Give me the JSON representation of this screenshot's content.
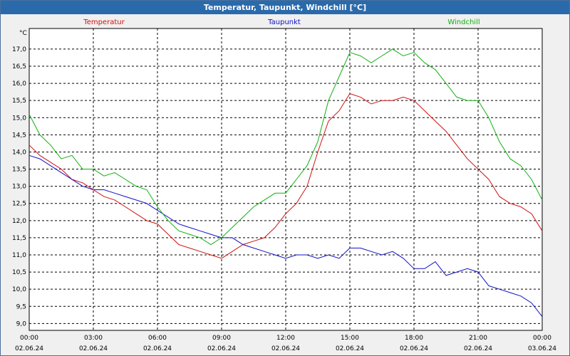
{
  "window": {
    "title": "Temperatur, Taupunkt, Windchill [°C]"
  },
  "chart_data": {
    "type": "line",
    "title": "Temperatur, Taupunkt, Windchill [°C]",
    "ylabel": "°C",
    "ylim": [
      8.8,
      17.6
    ],
    "xlim": [
      "02.06.24 00:00",
      "03.06.24 00:00"
    ],
    "grid": true,
    "legend": "top",
    "x_ticks": [
      {
        "time": "00:00",
        "date": "02.06.24"
      },
      {
        "time": "03:00",
        "date": "02.06.24"
      },
      {
        "time": "06:00",
        "date": "02.06.24"
      },
      {
        "time": "09:00",
        "date": "02.06.24"
      },
      {
        "time": "12:00",
        "date": "02.06.24"
      },
      {
        "time": "15:00",
        "date": "02.06.24"
      },
      {
        "time": "18:00",
        "date": "02.06.24"
      },
      {
        "time": "21:00",
        "date": "02.06.24"
      },
      {
        "time": "00:00",
        "date": "03.06.24"
      }
    ],
    "y_ticks": [
      "9,0",
      "9,5",
      "10,0",
      "10,5",
      "11,0",
      "11,5",
      "12,0",
      "12,5",
      "13,0",
      "13,5",
      "14,0",
      "14,5",
      "15,0",
      "15,5",
      "16,0",
      "16,5",
      "17,0"
    ],
    "series": [
      {
        "name": "Temperatur",
        "color": "#d01010",
        "points": [
          [
            "00:00",
            14.2
          ],
          [
            "00:30",
            13.9
          ],
          [
            "01:00",
            13.7
          ],
          [
            "01:30",
            13.5
          ],
          [
            "02:00",
            13.2
          ],
          [
            "02:30",
            13.1
          ],
          [
            "03:00",
            12.9
          ],
          [
            "03:30",
            12.7
          ],
          [
            "04:00",
            12.6
          ],
          [
            "04:30",
            12.4
          ],
          [
            "05:00",
            12.2
          ],
          [
            "05:30",
            12.0
          ],
          [
            "06:00",
            11.9
          ],
          [
            "06:30",
            11.6
          ],
          [
            "07:00",
            11.3
          ],
          [
            "07:30",
            11.2
          ],
          [
            "08:00",
            11.1
          ],
          [
            "08:30",
            11.0
          ],
          [
            "09:00",
            10.9
          ],
          [
            "09:30",
            11.1
          ],
          [
            "10:00",
            11.3
          ],
          [
            "10:30",
            11.4
          ],
          [
            "11:00",
            11.5
          ],
          [
            "11:30",
            11.8
          ],
          [
            "12:00",
            12.2
          ],
          [
            "12:30",
            12.5
          ],
          [
            "13:00",
            13.0
          ],
          [
            "13:30",
            14.0
          ],
          [
            "14:00",
            14.9
          ],
          [
            "14:30",
            15.2
          ],
          [
            "15:00",
            15.7
          ],
          [
            "15:30",
            15.6
          ],
          [
            "16:00",
            15.4
          ],
          [
            "16:30",
            15.5
          ],
          [
            "17:00",
            15.5
          ],
          [
            "17:30",
            15.6
          ],
          [
            "18:00",
            15.5
          ],
          [
            "18:30",
            15.2
          ],
          [
            "19:00",
            14.9
          ],
          [
            "19:30",
            14.6
          ],
          [
            "20:00",
            14.2
          ],
          [
            "20:30",
            13.8
          ],
          [
            "21:00",
            13.5
          ],
          [
            "21:30",
            13.2
          ],
          [
            "22:00",
            12.7
          ],
          [
            "22:30",
            12.5
          ],
          [
            "23:00",
            12.4
          ],
          [
            "23:30",
            12.2
          ],
          [
            "24:00",
            11.7
          ]
        ]
      },
      {
        "name": "Taupunkt",
        "color": "#1010c8",
        "points": [
          [
            "00:00",
            13.9
          ],
          [
            "00:30",
            13.8
          ],
          [
            "01:00",
            13.6
          ],
          [
            "01:30",
            13.4
          ],
          [
            "02:00",
            13.2
          ],
          [
            "02:30",
            13.0
          ],
          [
            "03:00",
            12.9
          ],
          [
            "03:30",
            12.9
          ],
          [
            "04:00",
            12.8
          ],
          [
            "04:30",
            12.7
          ],
          [
            "05:00",
            12.6
          ],
          [
            "05:30",
            12.5
          ],
          [
            "06:00",
            12.3
          ],
          [
            "06:30",
            12.1
          ],
          [
            "07:00",
            11.9
          ],
          [
            "07:30",
            11.8
          ],
          [
            "08:00",
            11.7
          ],
          [
            "08:30",
            11.6
          ],
          [
            "09:00",
            11.5
          ],
          [
            "09:30",
            11.5
          ],
          [
            "10:00",
            11.3
          ],
          [
            "10:30",
            11.2
          ],
          [
            "11:00",
            11.1
          ],
          [
            "11:30",
            11.0
          ],
          [
            "12:00",
            10.9
          ],
          [
            "12:30",
            11.0
          ],
          [
            "13:00",
            11.0
          ],
          [
            "13:30",
            10.9
          ],
          [
            "14:00",
            11.0
          ],
          [
            "14:30",
            10.9
          ],
          [
            "15:00",
            11.2
          ],
          [
            "15:30",
            11.2
          ],
          [
            "16:00",
            11.1
          ],
          [
            "16:30",
            11.0
          ],
          [
            "17:00",
            11.1
          ],
          [
            "17:30",
            10.9
          ],
          [
            "18:00",
            10.6
          ],
          [
            "18:30",
            10.6
          ],
          [
            "19:00",
            10.8
          ],
          [
            "19:30",
            10.4
          ],
          [
            "20:00",
            10.5
          ],
          [
            "20:30",
            10.6
          ],
          [
            "21:00",
            10.5
          ],
          [
            "21:30",
            10.1
          ],
          [
            "22:00",
            10.0
          ],
          [
            "22:30",
            9.9
          ],
          [
            "23:00",
            9.8
          ],
          [
            "23:30",
            9.6
          ],
          [
            "24:00",
            9.2
          ]
        ]
      },
      {
        "name": "Windchill",
        "color": "#10b010",
        "points": [
          [
            "00:00",
            15.1
          ],
          [
            "00:30",
            14.5
          ],
          [
            "01:00",
            14.2
          ],
          [
            "01:30",
            13.8
          ],
          [
            "02:00",
            13.9
          ],
          [
            "02:30",
            13.5
          ],
          [
            "03:00",
            13.5
          ],
          [
            "03:30",
            13.3
          ],
          [
            "04:00",
            13.4
          ],
          [
            "04:30",
            13.2
          ],
          [
            "05:00",
            13.0
          ],
          [
            "05:30",
            12.9
          ],
          [
            "06:00",
            12.4
          ],
          [
            "06:30",
            12.0
          ],
          [
            "07:00",
            11.7
          ],
          [
            "07:30",
            11.6
          ],
          [
            "08:00",
            11.5
          ],
          [
            "08:30",
            11.3
          ],
          [
            "09:00",
            11.5
          ],
          [
            "09:30",
            11.8
          ],
          [
            "10:00",
            12.1
          ],
          [
            "10:30",
            12.4
          ],
          [
            "11:00",
            12.6
          ],
          [
            "11:30",
            12.8
          ],
          [
            "12:00",
            12.8
          ],
          [
            "12:30",
            13.2
          ],
          [
            "13:00",
            13.6
          ],
          [
            "13:30",
            14.3
          ],
          [
            "14:00",
            15.5
          ],
          [
            "14:30",
            16.2
          ],
          [
            "15:00",
            16.9
          ],
          [
            "15:30",
            16.8
          ],
          [
            "16:00",
            16.6
          ],
          [
            "16:30",
            16.8
          ],
          [
            "17:00",
            17.0
          ],
          [
            "17:30",
            16.8
          ],
          [
            "18:00",
            16.9
          ],
          [
            "18:30",
            16.6
          ],
          [
            "19:00",
            16.4
          ],
          [
            "19:30",
            16.0
          ],
          [
            "20:00",
            15.6
          ],
          [
            "20:30",
            15.5
          ],
          [
            "21:00",
            15.5
          ],
          [
            "21:30",
            15.0
          ],
          [
            "22:00",
            14.3
          ],
          [
            "22:30",
            13.8
          ],
          [
            "23:00",
            13.6
          ],
          [
            "23:30",
            13.2
          ],
          [
            "24:00",
            12.6
          ]
        ]
      }
    ]
  }
}
